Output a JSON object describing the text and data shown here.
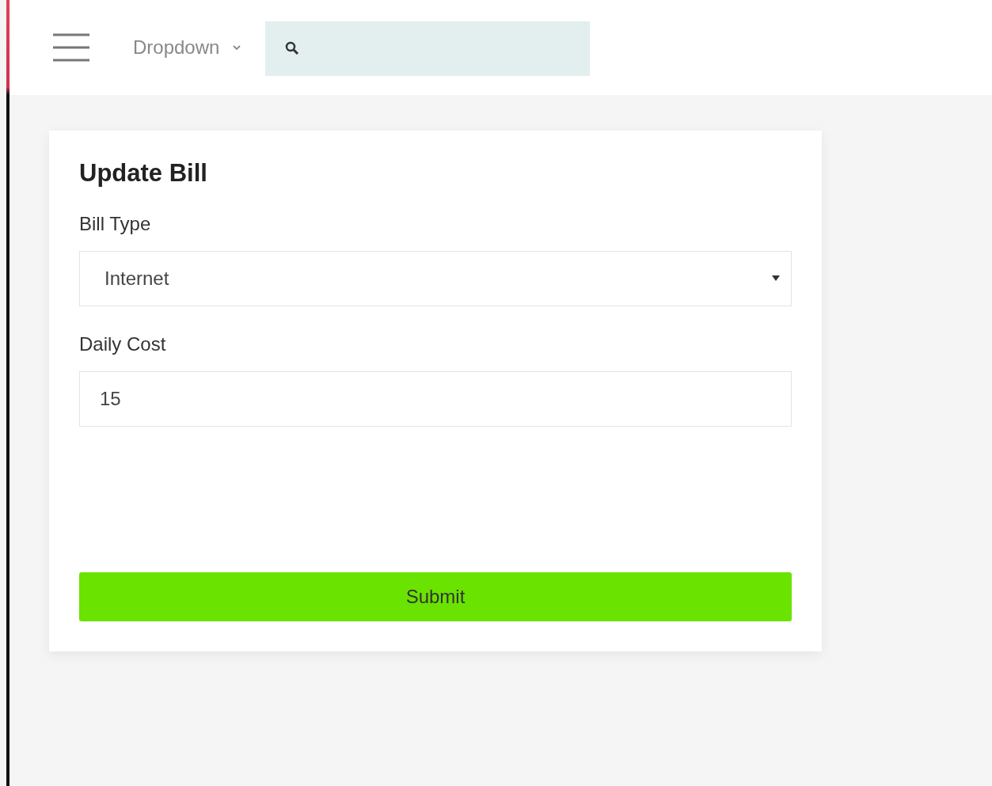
{
  "header": {
    "dropdown": {
      "label": "Dropdown"
    }
  },
  "form": {
    "title": "Update Bill",
    "fields": [
      {
        "kind": "select",
        "label": "Bill Type",
        "value": "Internet"
      },
      {
        "kind": "input",
        "label": "Daily Cost",
        "value": "15"
      }
    ],
    "submit": "Submit"
  }
}
